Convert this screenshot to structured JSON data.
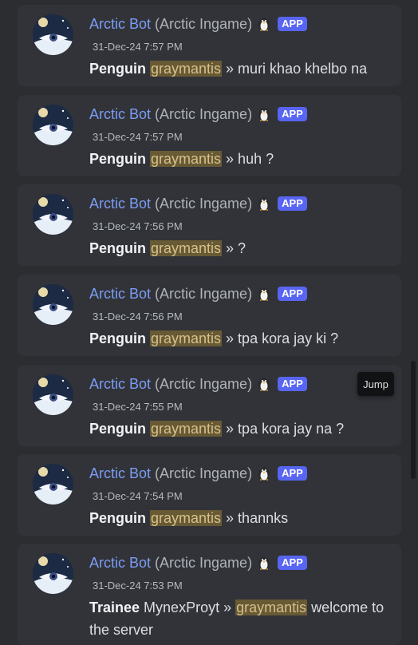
{
  "messages": [
    {
      "author": "Arctic Bot",
      "nickname": "(Arctic Ingame)",
      "tag": "APP",
      "timestamp": "31-Dec-24 7:57 PM",
      "role": "Penguin",
      "mention": "graymantis",
      "text": " » muri khao khelbo na"
    },
    {
      "author": "Arctic Bot",
      "nickname": "(Arctic Ingame)",
      "tag": "APP",
      "timestamp": "31-Dec-24 7:57 PM",
      "role": "Penguin",
      "mention": "graymantis",
      "text": " » huh ?"
    },
    {
      "author": "Arctic Bot",
      "nickname": "(Arctic Ingame)",
      "tag": "APP",
      "timestamp": "31-Dec-24 7:56 PM",
      "role": "Penguin",
      "mention": "graymantis",
      "text": " » ?"
    },
    {
      "author": "Arctic Bot",
      "nickname": "(Arctic Ingame)",
      "tag": "APP",
      "timestamp": "31-Dec-24 7:56 PM",
      "role": "Penguin",
      "mention": "graymantis",
      "text": " » tpa kora jay ki ?"
    },
    {
      "author": "Arctic Bot",
      "nickname": "(Arctic Ingame)",
      "tag": "APP",
      "timestamp": "31-Dec-24 7:55 PM",
      "role": "Penguin",
      "mention": "graymantis",
      "text": " » tpa kora jay na ?"
    },
    {
      "author": "Arctic Bot",
      "nickname": "(Arctic Ingame)",
      "tag": "APP",
      "timestamp": "31-Dec-24 7:54 PM",
      "role": "Penguin",
      "mention": "graymantis",
      "text": " » thannks"
    },
    {
      "author": "Arctic Bot",
      "nickname": "(Arctic Ingame)",
      "tag": "APP",
      "timestamp": "31-Dec-24 7:53 PM",
      "role": "Trainee",
      "sender": " MynexProyt » ",
      "mention": "graymantis",
      "text": " welcome to the server"
    }
  ],
  "jump_label": "Jump",
  "icons": {
    "avatar": "arctic-bot-avatar",
    "badge": "penguin-emoji-icon"
  },
  "colors": {
    "background": "#2b2d31",
    "card": "#313338",
    "author": "#7c9cf4",
    "app_tag": "#5865f2",
    "mention_bg": "#675a34"
  }
}
